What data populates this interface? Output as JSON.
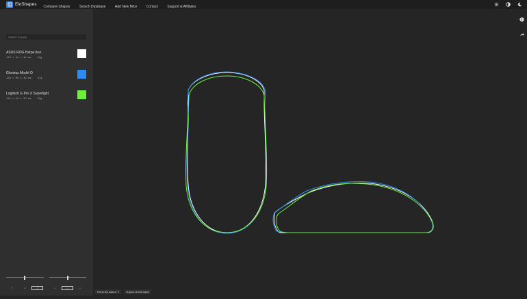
{
  "app": {
    "name": "EloShapes"
  },
  "nav": {
    "items": [
      "Compare Shapes",
      "Search Database",
      "Add New Mice",
      "Contact",
      "Support & Affiliates"
    ]
  },
  "top_icons": [
    "gear-icon",
    "contrast-icon",
    "moon-icon"
  ],
  "search": {
    "placeholder": "Select mouse"
  },
  "mice": [
    {
      "name": "ASUS ROG Harpe Ace",
      "dims": "128 x 64 x 40 mm    54g",
      "color": "#ffffff"
    },
    {
      "name": "Glorious Model O",
      "dims": "128 x 66 x 36 mm    67g",
      "color": "#2c8cf4"
    },
    {
      "name": "Logitech G Pro X Superlight",
      "dims": "125 x 64 x 40 mm    63g",
      "color": "#6cf03a"
    }
  ],
  "controls": {
    "up": "↑",
    "updown": "↕",
    "down": "↓",
    "left": "←",
    "leftright": "↔",
    "right": "→"
  },
  "bottom": {
    "sort": "Recently added",
    "support": "Support EloShapes"
  }
}
